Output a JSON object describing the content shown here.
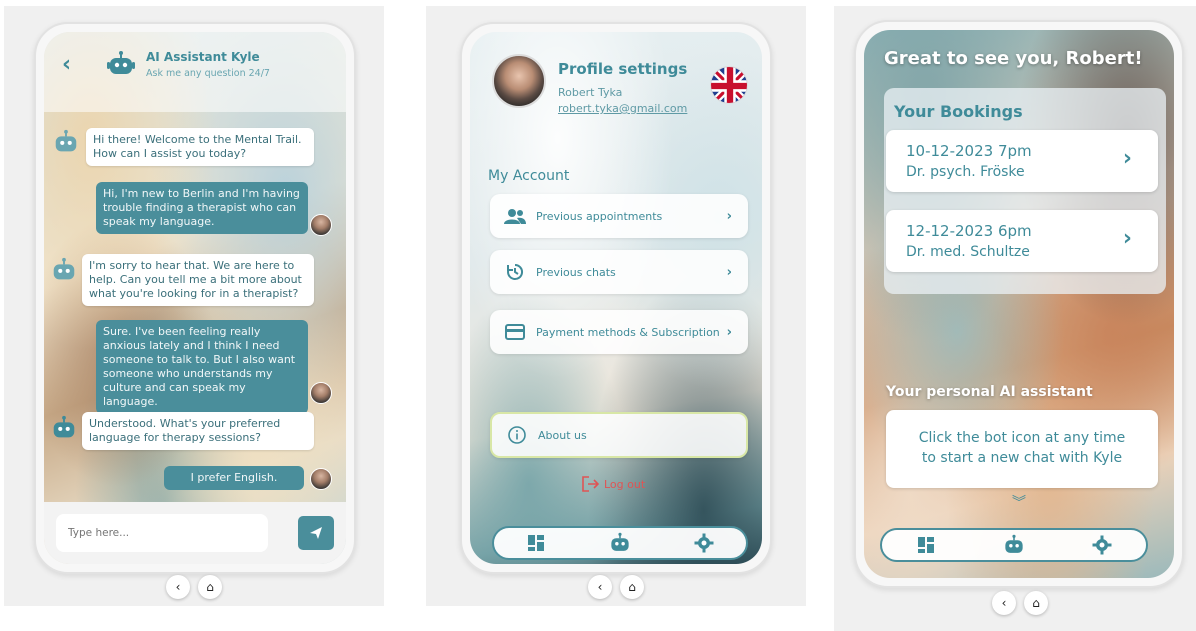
{
  "chat": {
    "back_icon": "chevron-left-icon",
    "title": "AI Assistant Kyle",
    "subtitle": "Ask me any question 24/7",
    "messages": [
      {
        "from": "bot",
        "text": "Hi there! Welcome to the Mental Trail. How can I assist you today?"
      },
      {
        "from": "user",
        "text": "Hi, I'm new to Berlin and I'm having trouble finding a therapist who can speak my language."
      },
      {
        "from": "bot",
        "text": "I'm sorry to hear that. We are here to help. Can you tell me a bit more about what you're looking for in a therapist?"
      },
      {
        "from": "user",
        "text": "Sure. I've been feeling really anxious lately and I think I need someone to talk to. But I also want someone who understands my culture and can speak my language."
      },
      {
        "from": "bot",
        "text": "Understood. What's your preferred language for therapy sessions?"
      },
      {
        "from": "user",
        "text": "I prefer English."
      }
    ],
    "input_placeholder": "Type here...",
    "send_icon": "send-icon"
  },
  "profile": {
    "title": "Profile settings",
    "name": "Robert Tyka",
    "email": "robert.tyka@gmail.com",
    "flag_icon": "uk-flag-icon",
    "section_title": "My Account",
    "menu": [
      {
        "label": "Previous appointments",
        "icon": "users-icon"
      },
      {
        "label": "Previous chats",
        "icon": "history-icon"
      },
      {
        "label": "Payment methods & Subscription",
        "icon": "credit-card-icon"
      }
    ],
    "about_label": "About us",
    "logout_label": "Log out"
  },
  "home": {
    "greeting": "Great to see you, Robert!",
    "bookings_title": "Your Bookings",
    "bookings": [
      {
        "date": "10-12-2023 7pm",
        "doctor": "Dr. psych. Fröske"
      },
      {
        "date": "12-12-2023 6pm",
        "doctor": " Dr. med. Schultze"
      }
    ],
    "ai_title": "Your personal AI assistant",
    "ai_line1": "Click the bot icon at any time",
    "ai_line2": "to start a new chat with Kyle"
  },
  "tabbar": [
    "dashboard-icon",
    "bot-icon",
    "gear-icon"
  ],
  "colors": {
    "accent": "#3f8b99",
    "user_bubble": "#4a8e9b",
    "logout": "#e05454"
  }
}
